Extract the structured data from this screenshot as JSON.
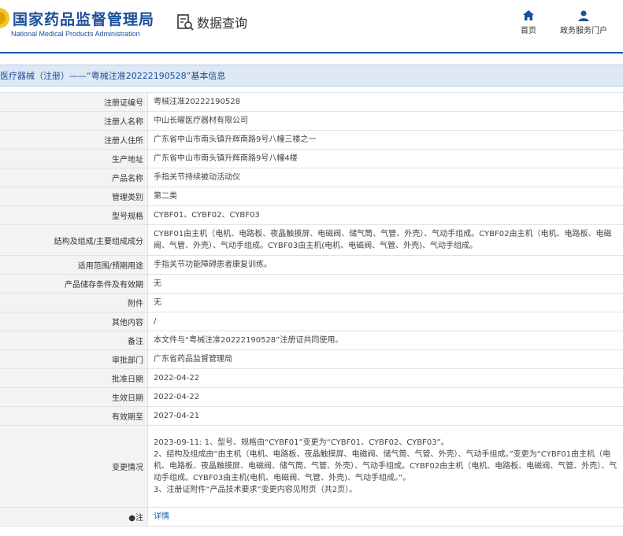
{
  "header": {
    "logo_cn": "国家药品监督管理局",
    "logo_en": "National Medical Products Administration",
    "query_label": "数据查询",
    "nav_home": "首页",
    "nav_service": "政务服务门户"
  },
  "page_title": "医疗器械（注册）——“粤械注准20222190528”基本信息",
  "rows": [
    {
      "key": "注册证编号",
      "value": "粤械注准20222190528"
    },
    {
      "key": "注册人名称",
      "value": "中山长曜医疗器材有限公司"
    },
    {
      "key": "注册人住所",
      "value": "广东省中山市南头镇升辉南路9号八幢三楼之一"
    },
    {
      "key": "生产地址",
      "value": "广东省中山市南头镇升辉南路9号八幢4楼"
    },
    {
      "key": "产品名称",
      "value": "手指关节持续被动活动仪"
    },
    {
      "key": "管理类别",
      "value": "第二类"
    },
    {
      "key": "型号规格",
      "value": "CYBF01、CYBF02、CYBF03"
    },
    {
      "key": "结构及组成/主要组成成分",
      "value": "CYBF01由主机（电机、电路板、夜晶触摸屏、电磁阀、储气筒、气管、外壳）、气动手组成。CYBF02由主机（电机、电路板、电磁阀、气管、外壳）、气动手组成。CYBF03由主机(电机、电磁阀、气管、外壳)、气动手组成。"
    },
    {
      "key": "适用范围/预期用途",
      "value": "手指关节功能障碍患者康复训练。"
    },
    {
      "key": "产品储存条件及有效期",
      "value": "无"
    },
    {
      "key": "附件",
      "value": "无"
    },
    {
      "key": "其他内容",
      "value": "/"
    },
    {
      "key": "备注",
      "value": "本文件与“粤械注准20222190528”注册证共同使用。"
    },
    {
      "key": "审批部门",
      "value": "广东省药品监督管理局"
    },
    {
      "key": "批准日期",
      "value": "2022-04-22"
    },
    {
      "key": "生效日期",
      "value": "2022-04-22"
    },
    {
      "key": "有效期至",
      "value": "2027-04-21"
    }
  ],
  "change": {
    "key": "变更情况",
    "lines": [
      "2023-09-11: 1、型号、规格由“CYBF01”变更为“CYBF01、CYBF02、CYBF03”。",
      "2、结构及组成由“由主机（电机、电路板、夜晶触摸屏、电磁阀、储气筒、气管、外壳）、气动手组成。”变更为“CYBF01由主机（电机、电路板、夜晶触摸屏、电磁阀、储气筒、气管、外壳）、气动手组成。CYBF02由主机（电机、电路板、电磁阀、气管、外壳）、气动手组成。CYBF03由主机(电机、电磁阀、气管、外壳)、气动手组成。”。",
      "3、注册证附件“产品技术要求”变更内容见附页（共2页）。"
    ]
  },
  "note": {
    "key": "●注",
    "link": "详情"
  }
}
